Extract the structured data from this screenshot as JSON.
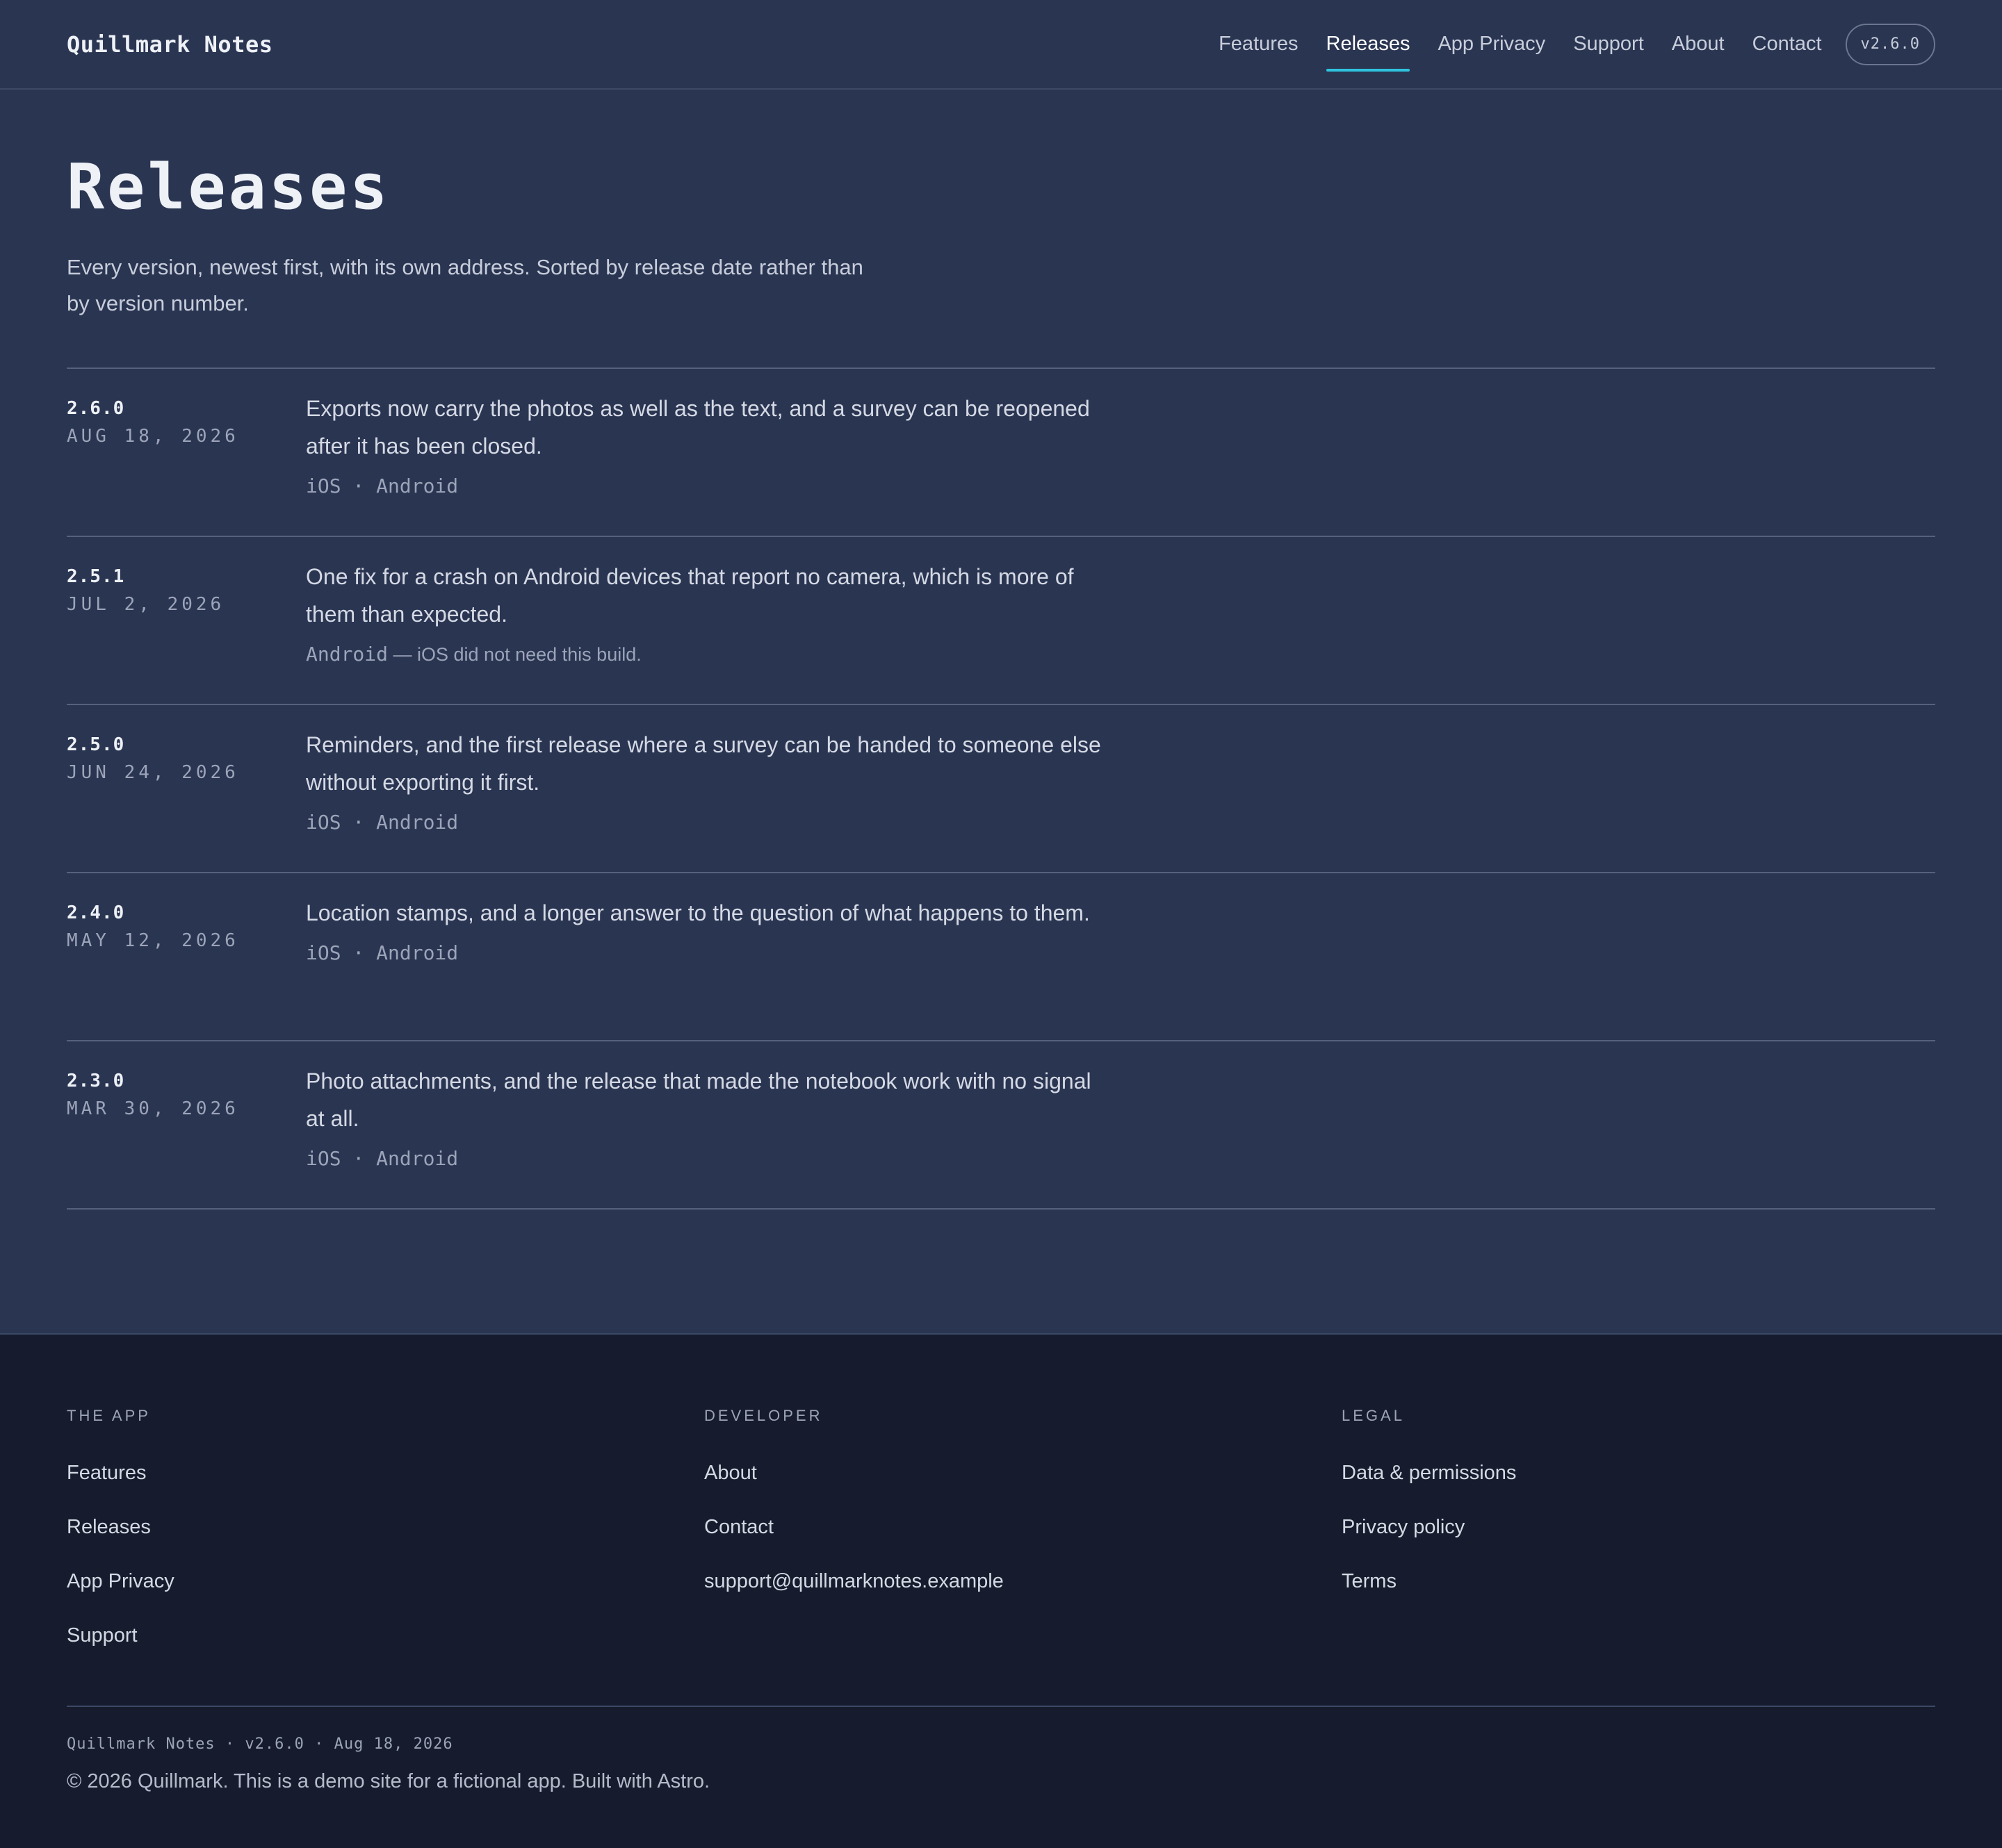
{
  "header": {
    "brand": "Quillmark Notes",
    "nav": [
      {
        "label": "Features"
      },
      {
        "label": "Releases",
        "active": true
      },
      {
        "label": "App Privacy"
      },
      {
        "label": "Support"
      },
      {
        "label": "About"
      },
      {
        "label": "Contact"
      }
    ],
    "version": "v2.6.0"
  },
  "main": {
    "title": "Releases",
    "intro": "Every version, newest first, with its own address. Sorted by release date rather than by version number.",
    "releases": [
      {
        "version": "2.6.0",
        "date": "AUG 18, 2026",
        "summary": "Exports now carry the photos as well as the text, and a survey can be reopened after it has been closed.",
        "platforms": "iOS · Android"
      },
      {
        "version": "2.5.1",
        "date": "JUL 2, 2026",
        "summary": "One fix for a crash on Android devices that report no camera, which is more of them than expected.",
        "platforms": "Android",
        "note": " — iOS did not need this build."
      },
      {
        "version": "2.5.0",
        "date": "JUN 24, 2026",
        "summary": "Reminders, and the first release where a survey can be handed to someone else without exporting it first.",
        "platforms": "iOS · Android"
      },
      {
        "version": "2.4.0",
        "date": "MAY 12, 2026",
        "summary": "Location stamps, and a longer answer to the question of what happens to them.",
        "platforms": "iOS · Android"
      },
      {
        "version": "2.3.0",
        "date": "MAR 30, 2026",
        "summary": "Photo attachments, and the release that made the notebook work with no signal at all.",
        "platforms": "iOS · Android"
      }
    ]
  },
  "footer": {
    "columns": [
      {
        "heading": "THE APP",
        "links": [
          "Features",
          "Releases",
          "App Privacy",
          "Support"
        ]
      },
      {
        "heading": "DEVELOPER",
        "links": [
          "About",
          "Contact",
          "support@quillmarknotes.example"
        ]
      },
      {
        "heading": "LEGAL",
        "links": [
          "Data & permissions",
          "Privacy policy",
          "Terms"
        ]
      }
    ],
    "meta": "Quillmark Notes · v2.6.0 · Aug 18, 2026",
    "copyright": "© 2026 Quillmark. This is a demo site for a fictional app. Built with Astro."
  },
  "colors": {
    "background": "#2a3552",
    "footer_background": "#161c2d",
    "accent": "#2ec4de"
  }
}
